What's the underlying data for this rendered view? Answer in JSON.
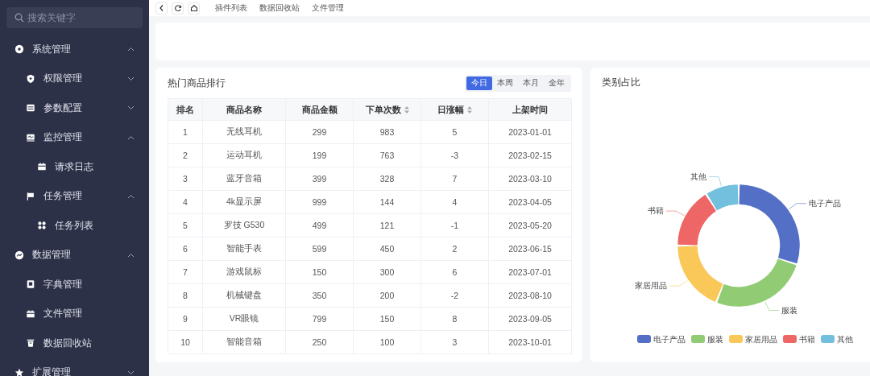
{
  "sidebar": {
    "search": {
      "placeholder": "搜索关键字"
    },
    "menu": [
      {
        "label": "系统管理",
        "expanded": true,
        "children": [
          {
            "label": "权限管理",
            "expanded": false
          },
          {
            "label": "参数配置",
            "expanded": false
          },
          {
            "label": "监控管理",
            "expanded": true,
            "children": [
              {
                "label": "请求日志"
              }
            ]
          },
          {
            "label": "任务管理",
            "expanded": true,
            "children": [
              {
                "label": "任务列表"
              }
            ]
          }
        ]
      },
      {
        "label": "数据管理",
        "expanded": true,
        "children": [
          {
            "label": "字典管理"
          },
          {
            "label": "文件管理"
          },
          {
            "label": "数据回收站"
          }
        ]
      },
      {
        "label": "扩展管理",
        "expanded": false
      }
    ]
  },
  "toolbar": {
    "tabs": [
      "插件列表",
      "数据回收站",
      "文件管理"
    ]
  },
  "ranking": {
    "title": "热门商品排行",
    "periods": [
      {
        "label": "今日",
        "selected": true
      },
      {
        "label": "本周",
        "selected": false
      },
      {
        "label": "本月",
        "selected": false
      },
      {
        "label": "全年",
        "selected": false
      }
    ],
    "columns": [
      {
        "label": "排名",
        "sortable": false
      },
      {
        "label": "商品名称",
        "sortable": false
      },
      {
        "label": "商品金额",
        "sortable": false
      },
      {
        "label": "下单次数",
        "sortable": true
      },
      {
        "label": "日涨幅",
        "sortable": true
      },
      {
        "label": "上架时间",
        "sortable": false
      }
    ],
    "rows": [
      [
        "1",
        "无线耳机",
        "299",
        "983",
        "5",
        "2023-01-01"
      ],
      [
        "2",
        "运动耳机",
        "199",
        "763",
        "-3",
        "2023-02-15"
      ],
      [
        "3",
        "蓝牙音箱",
        "399",
        "328",
        "7",
        "2023-03-10"
      ],
      [
        "4",
        "4k显示屏",
        "999",
        "144",
        "4",
        "2023-04-05"
      ],
      [
        "5",
        "罗技 G530",
        "499",
        "121",
        "-1",
        "2023-05-20"
      ],
      [
        "6",
        "智能手表",
        "599",
        "450",
        "2",
        "2023-06-15"
      ],
      [
        "7",
        "游戏鼠标",
        "150",
        "300",
        "6",
        "2023-07-01"
      ],
      [
        "8",
        "机械键盘",
        "350",
        "200",
        "-2",
        "2023-08-10"
      ],
      [
        "9",
        "VR眼镜",
        "799",
        "150",
        "8",
        "2023-09-05"
      ],
      [
        "10",
        "智能音箱",
        "250",
        "100",
        "3",
        "2023-10-01"
      ]
    ]
  },
  "category": {
    "title": "类别占比",
    "slices": [
      {
        "label": "电子产品",
        "color": "#5470c6"
      },
      {
        "label": "服装",
        "color": "#91cc75"
      },
      {
        "label": "家居用品",
        "color": "#fac858"
      },
      {
        "label": "书籍",
        "color": "#ee6666"
      },
      {
        "label": "其他",
        "color": "#73c0de"
      }
    ],
    "legend": [
      {
        "label": "电子产品",
        "color": "#5470c6"
      },
      {
        "label": "服装",
        "color": "#91cc75"
      },
      {
        "label": "家居用品",
        "color": "#fac858"
      },
      {
        "label": "书籍",
        "color": "#ee6666"
      },
      {
        "label": "其他",
        "color": "#73c0de"
      }
    ]
  }
}
